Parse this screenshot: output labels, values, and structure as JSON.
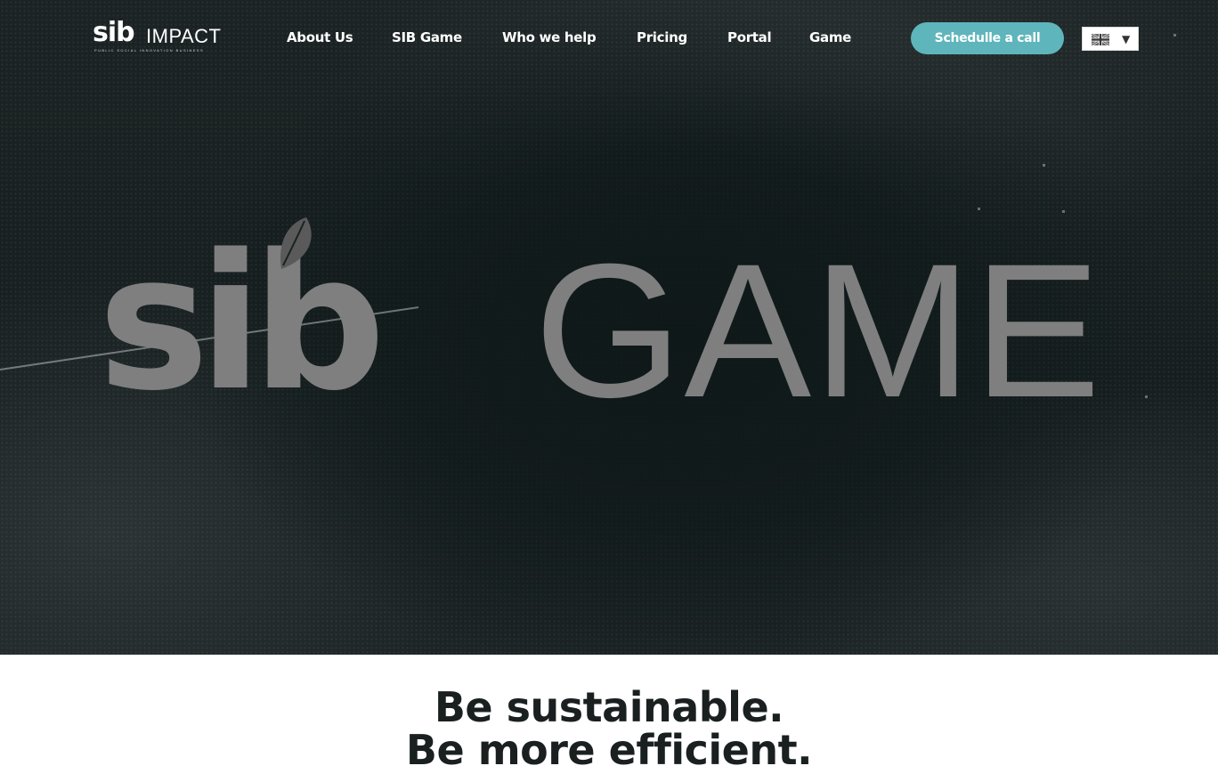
{
  "header": {
    "logo": {
      "brand": "sib",
      "product": "IMPACT",
      "tagline": "PUBLIC SOCIAL INNOVATION BUSINESS"
    },
    "nav": [
      {
        "label": "About Us"
      },
      {
        "label": "SIB Game"
      },
      {
        "label": "Who we help"
      },
      {
        "label": "Pricing"
      },
      {
        "label": "Portal"
      },
      {
        "label": "Game"
      }
    ],
    "cta_label": "Schedulle a call",
    "language": {
      "flag_icon": "uk-flag-icon",
      "caret": "▼"
    }
  },
  "hero": {
    "logo_brand": "sib",
    "logo_word": "GAME"
  },
  "intro": {
    "line1": "Be sustainable.",
    "line2": "Be more efficient."
  },
  "colors": {
    "hero_background": "#161e1f",
    "hero_logo": "#7f7f7f",
    "cta_background": "#5fb5bc",
    "headline_text": "#1a1f20"
  }
}
